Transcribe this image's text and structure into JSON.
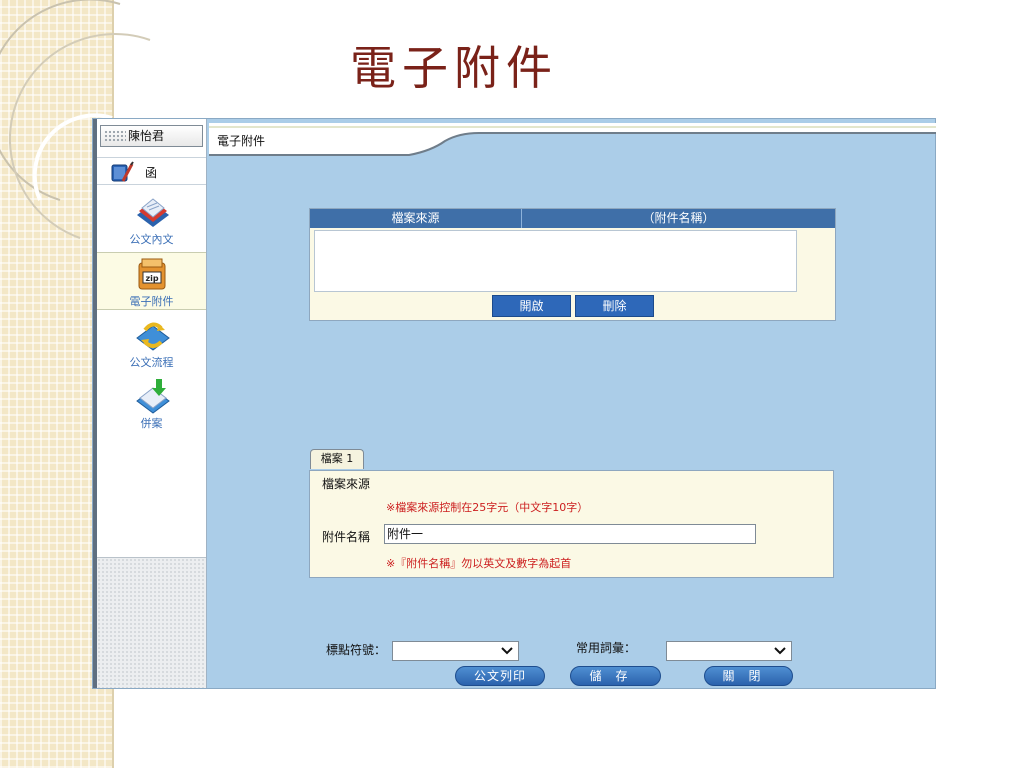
{
  "slide": {
    "title": "電子附件"
  },
  "sidebar": {
    "user_name": "陳怡君",
    "doc_type": "函",
    "items": [
      {
        "label": "公文內文",
        "icon": "document-folder-icon"
      },
      {
        "label": "電子附件",
        "icon": "zip-file-icon"
      },
      {
        "label": "公文流程",
        "icon": "workflow-arrows-icon"
      },
      {
        "label": "併案",
        "icon": "merge-download-icon"
      }
    ]
  },
  "main": {
    "title": "電子附件",
    "attachment_table": {
      "col_source": "檔案來源",
      "col_name": "（附件名稱）",
      "open_button": "開啟",
      "delete_button": "刪除"
    },
    "file_tab": "檔案 1",
    "form": {
      "source_label": "檔案來源",
      "source_note": "※檔案來源控制在25字元（中文字10字）",
      "name_label": "附件名稱",
      "name_value": "附件一",
      "name_note": "※『附件名稱』勿以英文及數字為起首"
    },
    "bottom": {
      "punctuation_label": "標點符號：",
      "phrases_label": "常用詞彙：",
      "print_button": "公文列印",
      "save_button": "儲存",
      "close_button": "關閉"
    }
  },
  "colors": {
    "title": "#7a2219",
    "panel_bg": "#abcde8",
    "header_blue": "#3f6fa8",
    "note_red": "#cc1f1f",
    "form_bg": "#fbf9e5"
  }
}
